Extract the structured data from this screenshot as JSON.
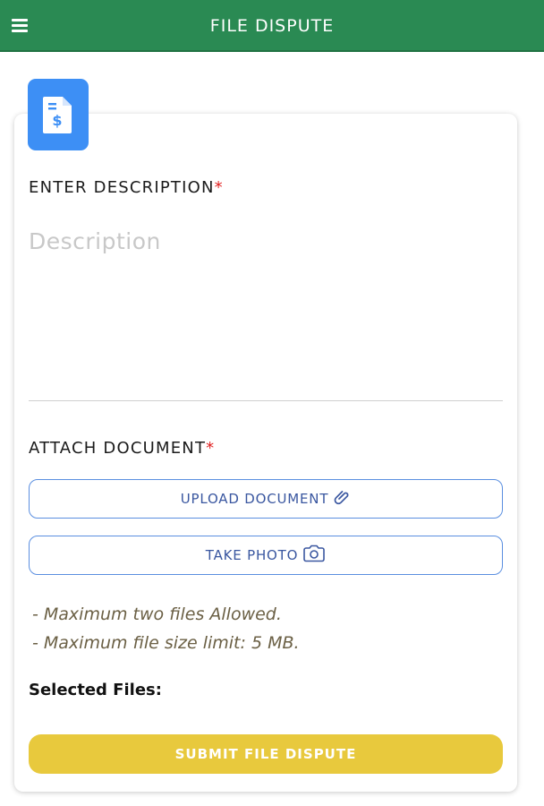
{
  "appbar": {
    "title": "FILE DISPUTE",
    "menu_icon": "hamburger-menu-icon",
    "background": "#2a8a53"
  },
  "form": {
    "header_icon": "document-dollar-icon",
    "description": {
      "label": "ENTER DESCRIPTION",
      "required_marker": "*",
      "placeholder": "Description",
      "value": ""
    },
    "attach": {
      "label": "ATTACH DOCUMENT",
      "required_marker": "*",
      "upload_button": {
        "label": "UPLOAD DOCUMENT",
        "icon": "paperclip-icon"
      },
      "photo_button": {
        "label": "TAKE PHOTO",
        "icon": "camera-icon"
      },
      "notes": [
        "- Maximum two files Allowed.",
        "- Maximum file size limit: 5 MB."
      ]
    },
    "selected_files_label": "Selected Files:",
    "submit_label": "SUBMIT FILE DISPUTE"
  },
  "colors": {
    "accent_blue": "#3d8ff5",
    "submit_yellow": "#e8c93d",
    "required_red": "#e02020"
  }
}
